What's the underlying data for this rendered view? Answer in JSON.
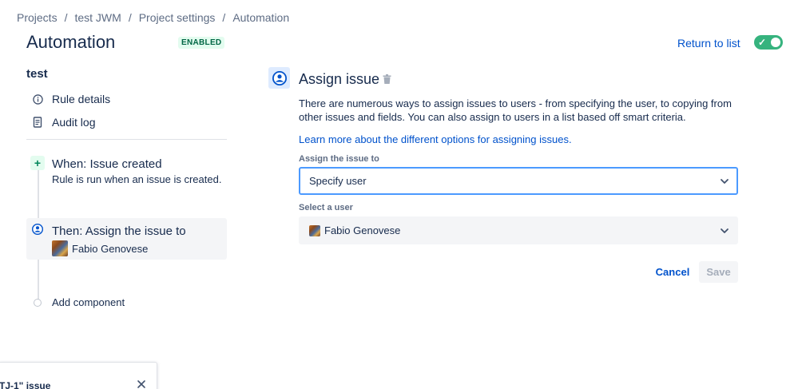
{
  "breadcrumb": [
    "Projects",
    "test JWM",
    "Project settings",
    "Automation"
  ],
  "header": {
    "title": "Automation",
    "status": "ENABLED",
    "return_label": "Return to list",
    "toggle_on": true
  },
  "sidebar": {
    "rule_name": "test",
    "items": [
      {
        "label": "Rule details",
        "icon": "info-icon"
      },
      {
        "label": "Audit log",
        "icon": "document-icon"
      }
    ]
  },
  "flow": {
    "trigger": {
      "title": "When: Issue created",
      "desc": "Rule is run when an issue is created."
    },
    "action": {
      "title": "Then: Assign the issue to",
      "user": "Fabio Genovese"
    },
    "add_component": "Add component"
  },
  "detail": {
    "title": "Assign issue",
    "description": "There are numerous ways to assign issues to users - from specifying the user, to copying from other issues and fields. You can also assign to users in a list based off smart criteria.",
    "learn_link": "Learn more about the different options for assigning issues.",
    "assign_label": "Assign the issue to",
    "assign_value": "Specify user",
    "user_label": "Select a user",
    "user_value": "Fabio Genovese",
    "cancel": "Cancel",
    "save": "Save"
  },
  "bottom_panel": {
    "text": "TJ-1\" issue"
  },
  "colors": {
    "accent": "#0052cc",
    "success": "#36b37e",
    "focus": "#4c9aff"
  }
}
